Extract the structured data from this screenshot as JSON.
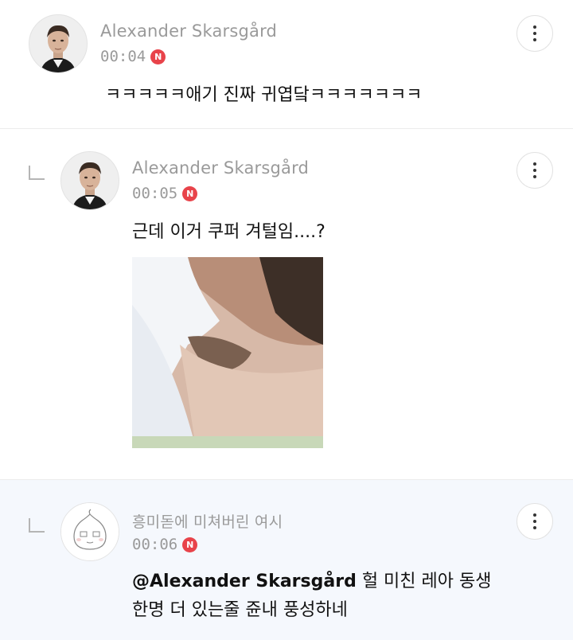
{
  "comments": [
    {
      "author": "Alexander Skarsgård",
      "time": "00:04",
      "badge": "N",
      "text": "ㅋㅋㅋㅋㅋ애기 진짜 귀엽닼ㅋㅋㅋㅋㅋㅋㅋ"
    },
    {
      "author": "Alexander Skarsgård",
      "time": "00:05",
      "badge": "N",
      "text": "근데 이거 쿠퍼 겨털임....?"
    },
    {
      "author": "흥미돋에 미쳐버린 여시",
      "time": "00:06",
      "badge": "N",
      "mention": "@Alexander Skarsgård",
      "text_line1": " 헐 미친 레아 동생",
      "text_line2": "한명 더 있는줄 쥰내 풍성하네"
    }
  ],
  "icons": {
    "more": "more-vertical-icon",
    "reply": "reply-arrow-icon",
    "new": "new-badge-icon"
  },
  "colors": {
    "badge": "#e8434a",
    "meta_text": "#9a9a9a",
    "highlight_bg": "#f5f8fd"
  }
}
